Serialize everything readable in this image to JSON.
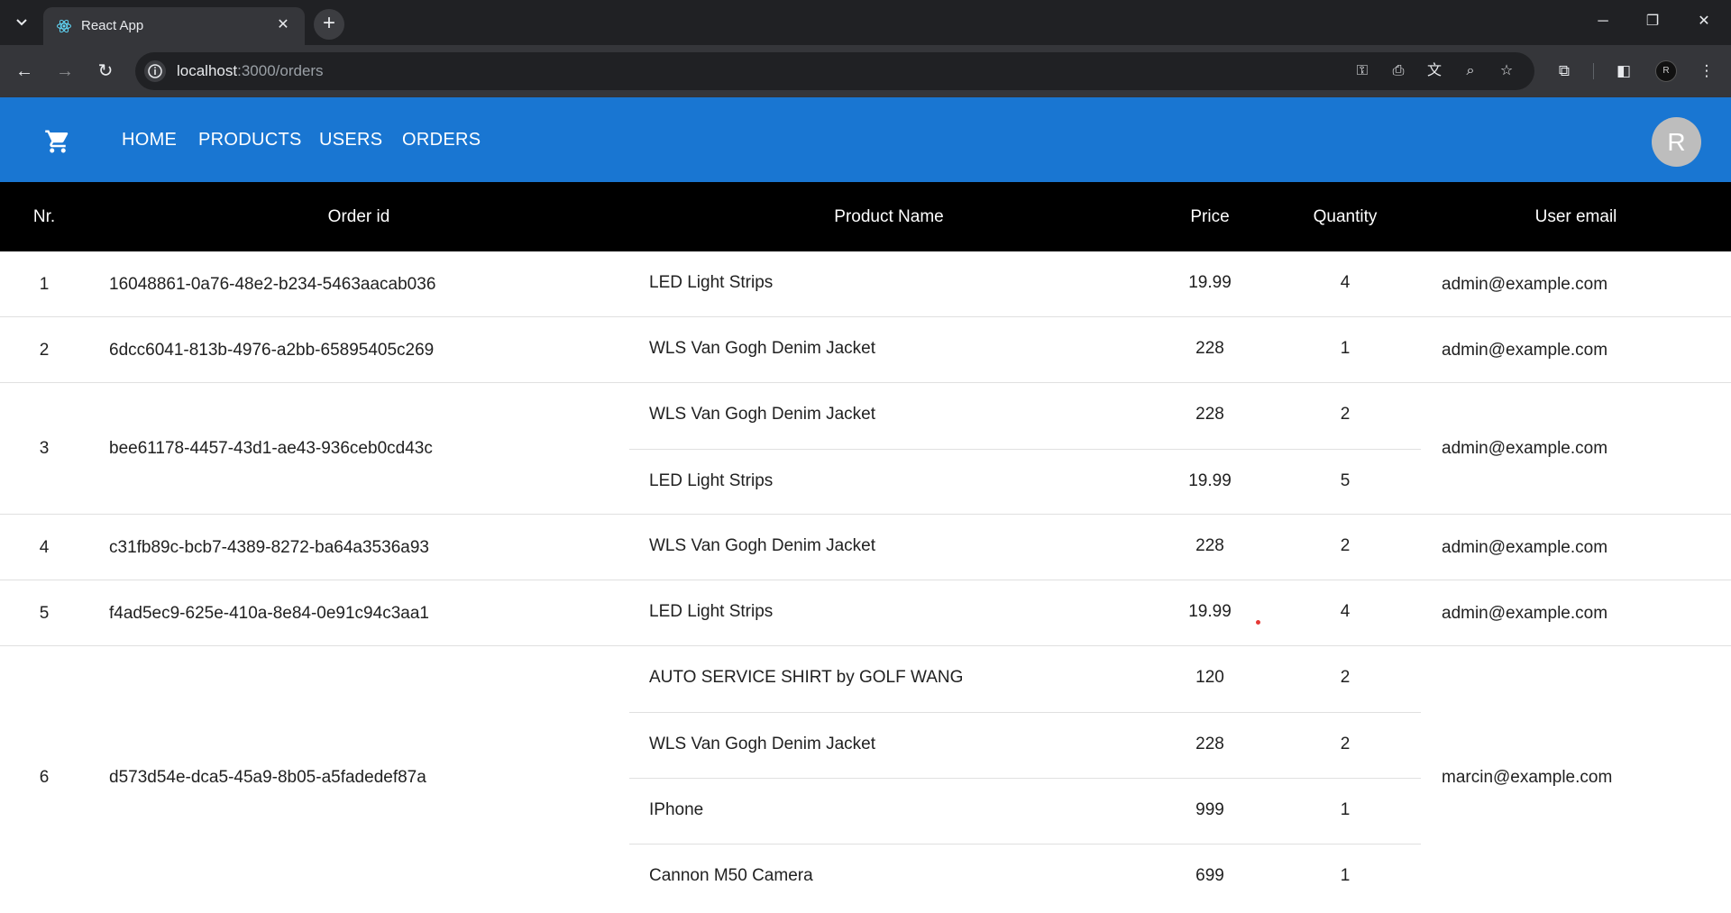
{
  "browser": {
    "tab_title": "React App",
    "url_host": "localhost",
    "url_path": ":3000/orders",
    "profile_initial": "R",
    "icons": [
      "tab-search-icon",
      "react-logo-icon",
      "close-icon",
      "plus-icon",
      "minimize-icon",
      "restore-icon",
      "window-close-icon",
      "back-icon",
      "forward-icon",
      "reload-icon",
      "site-info-icon",
      "key-icon",
      "install-icon",
      "translate-icon",
      "zoom-icon",
      "star-icon",
      "extensions-icon",
      "side-panel-icon",
      "more-icon"
    ]
  },
  "appbar": {
    "color": "#1976d2",
    "nav": [
      "HOME",
      "PRODUCTS",
      "USERS",
      "ORDERS"
    ],
    "avatar_initial": "R",
    "icon": "shopping-cart-icon"
  },
  "table": {
    "headers": {
      "nr": "Nr.",
      "order_id": "Order id",
      "product_name": "Product Name",
      "price": "Price",
      "quantity": "Quantity",
      "user_email": "User email"
    },
    "orders": [
      {
        "nr": "1",
        "order_id": "16048861-0a76-48e2-b234-5463aacab036",
        "email": "admin@example.com",
        "items": [
          {
            "name": "LED Light Strips",
            "price": "19.99",
            "qty": "4"
          }
        ]
      },
      {
        "nr": "2",
        "order_id": "6dcc6041-813b-4976-a2bb-65895405c269",
        "email": "admin@example.com",
        "items": [
          {
            "name": "WLS Van Gogh Denim Jacket",
            "price": "228",
            "qty": "1"
          }
        ]
      },
      {
        "nr": "3",
        "order_id": "bee61178-4457-43d1-ae43-936ceb0cd43c",
        "email": "admin@example.com",
        "items": [
          {
            "name": "WLS Van Gogh Denim Jacket",
            "price": "228",
            "qty": "2"
          },
          {
            "name": "LED Light Strips",
            "price": "19.99",
            "qty": "5"
          }
        ]
      },
      {
        "nr": "4",
        "order_id": "c31fb89c-bcb7-4389-8272-ba64a3536a93",
        "email": "admin@example.com",
        "items": [
          {
            "name": "WLS Van Gogh Denim Jacket",
            "price": "228",
            "qty": "2"
          }
        ]
      },
      {
        "nr": "5",
        "order_id": "f4ad5ec9-625e-410a-8e84-0e91c94c3aa1",
        "email": "admin@example.com",
        "items": [
          {
            "name": "LED Light Strips",
            "price": "19.99",
            "qty": "4"
          }
        ]
      },
      {
        "nr": "6",
        "order_id": "d573d54e-dca5-45a9-8b05-a5fadedef87a",
        "email": "marcin@example.com",
        "items": [
          {
            "name": "AUTO SERVICE SHIRT by GOLF WANG",
            "price": "120",
            "qty": "2"
          },
          {
            "name": "WLS Van Gogh Denim Jacket",
            "price": "228",
            "qty": "2"
          },
          {
            "name": "IPhone",
            "price": "999",
            "qty": "1"
          },
          {
            "name": "Cannon M50 Camera",
            "price": "699",
            "qty": "1"
          }
        ]
      }
    ]
  }
}
